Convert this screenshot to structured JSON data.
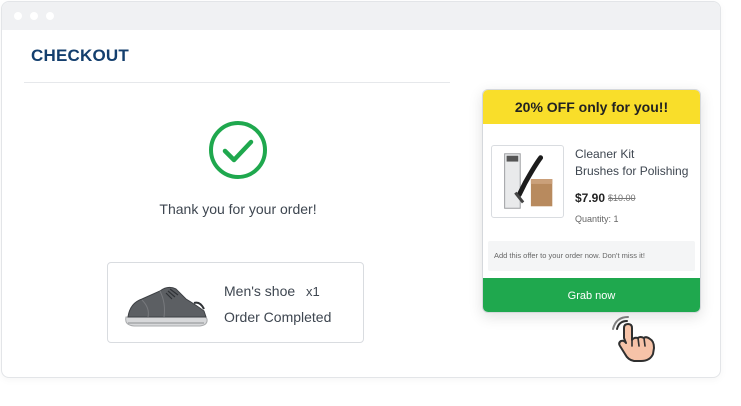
{
  "page": {
    "title": "CHECKOUT",
    "thank_you": "Thank you for your order!"
  },
  "order": {
    "item_name": "Men's shoe",
    "quantity": "x1",
    "status": "Order Completed"
  },
  "offer": {
    "header": "20% OFF only for you!!",
    "product_name_line1": "Cleaner Kit",
    "product_name_line2": "Brushes for Polishing",
    "price": "$7.90",
    "old_price": "$10.00",
    "quantity": "Quantity: 1",
    "note": "Add this offer to your order now. Don't miss it!",
    "button": "Grab now"
  },
  "colors": {
    "title_blue": "#143f6e",
    "success_green": "#1fa84e",
    "banner_yellow": "#f9de2a"
  },
  "icons": {
    "status": "check-circle-icon",
    "cursor": "pointing-hand-icon"
  }
}
